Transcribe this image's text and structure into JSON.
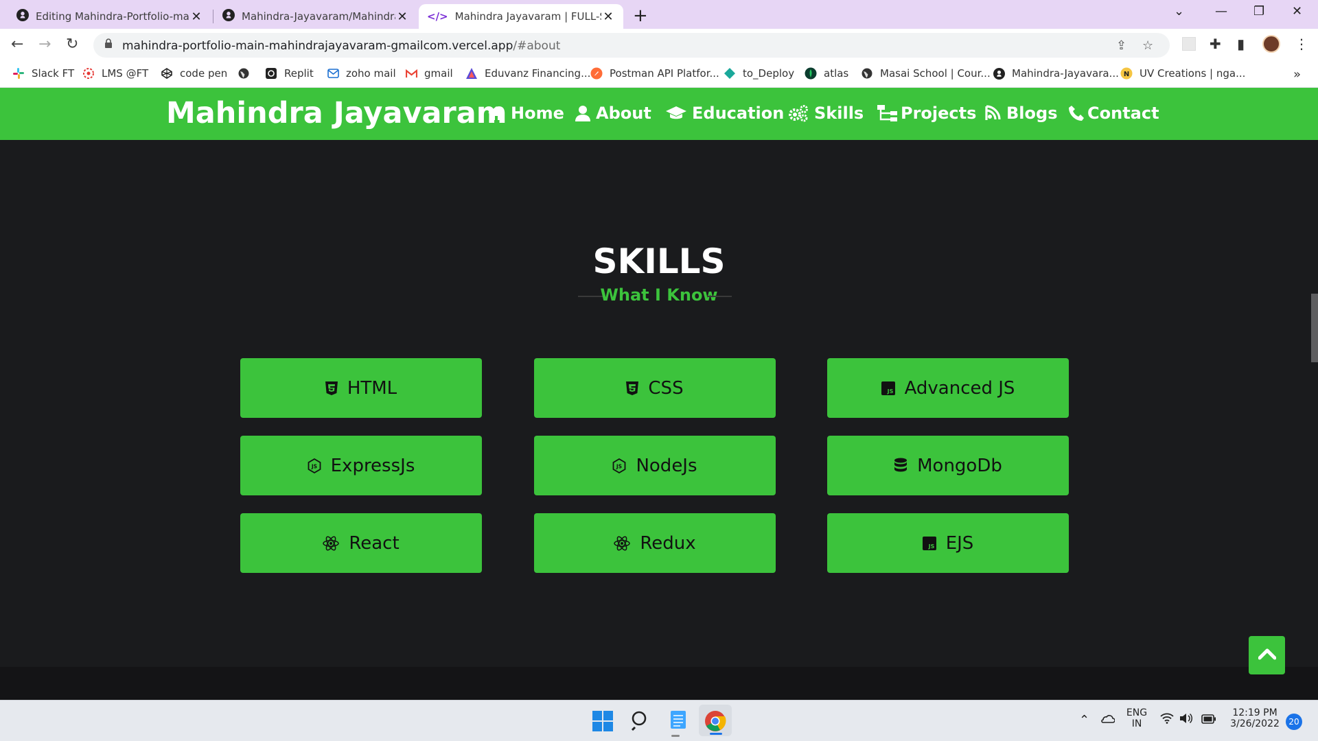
{
  "browser": {
    "tabs": [
      {
        "title": "Editing Mahindra-Portfolio-main",
        "icon": "github-icon"
      },
      {
        "title": "Mahindra-Jayavaram/Mahindra-P",
        "icon": "github-icon"
      },
      {
        "title": "Mahindra Jayavaram | FULL-STAC",
        "icon": "code-icon"
      }
    ],
    "url_host": "mahindra-portfolio-main-mahindrajayavaram-gmailcom.vercel.app",
    "url_path": "/#about",
    "bookmarks": [
      {
        "label": "Slack FT",
        "icon": "slack-icon"
      },
      {
        "label": "LMS @FT",
        "icon": "lms-icon"
      },
      {
        "label": "code pen",
        "icon": "codepen-icon"
      },
      {
        "label": "",
        "icon": "globe-icon"
      },
      {
        "label": "Replit",
        "icon": "replit-icon"
      },
      {
        "label": "zoho mail",
        "icon": "zoho-mail-icon"
      },
      {
        "label": "gmail",
        "icon": "gmail-icon"
      },
      {
        "label": "Eduvanz Financing...",
        "icon": "eduvanz-icon"
      },
      {
        "label": "Postman API Platfor...",
        "icon": "postman-icon"
      },
      {
        "label": "to_Deploy",
        "icon": "deploy-icon"
      },
      {
        "label": "atlas",
        "icon": "mongodb-atlas-icon"
      },
      {
        "label": "Masai School | Cour...",
        "icon": "globe-icon"
      },
      {
        "label": "Mahindra-Jayavara...",
        "icon": "github-icon"
      },
      {
        "label": "UV Creations | nga...",
        "icon": "uv-creations-icon"
      }
    ]
  },
  "header": {
    "brand": "Mahindra Jayavaram",
    "nav": [
      {
        "label": "Home",
        "icon": "home-icon"
      },
      {
        "label": "About",
        "icon": "user-icon"
      },
      {
        "label": "Education",
        "icon": "graduation-cap-icon"
      },
      {
        "label": "Skills",
        "icon": "gears-icon"
      },
      {
        "label": "Projects",
        "icon": "sitemap-icon"
      },
      {
        "label": "Blogs",
        "icon": "blog-icon"
      },
      {
        "label": "Contact",
        "icon": "phone-icon"
      }
    ]
  },
  "skills": {
    "title": "SKILLS",
    "subtitle": "What I Know",
    "items": [
      {
        "label": "HTML",
        "icon": "html5-icon"
      },
      {
        "label": "CSS",
        "icon": "css3-icon"
      },
      {
        "label": "Advanced JS",
        "icon": "js-icon"
      },
      {
        "label": "ExpressJs",
        "icon": "nodejs-icon"
      },
      {
        "label": "NodeJs",
        "icon": "nodejs-icon"
      },
      {
        "label": "MongoDb",
        "icon": "database-icon"
      },
      {
        "label": "React",
        "icon": "react-icon"
      },
      {
        "label": "Redux",
        "icon": "react-icon"
      },
      {
        "label": "EJS",
        "icon": "js-icon"
      }
    ]
  },
  "taskbar": {
    "language_line1": "ENG",
    "language_line2": "IN",
    "time": "12:19 PM",
    "date": "3/26/2022",
    "notifications": "20"
  },
  "colors": {
    "accent": "#3cc33c",
    "background": "#1a1b1d",
    "tabstrip": "#e7d6f5"
  }
}
